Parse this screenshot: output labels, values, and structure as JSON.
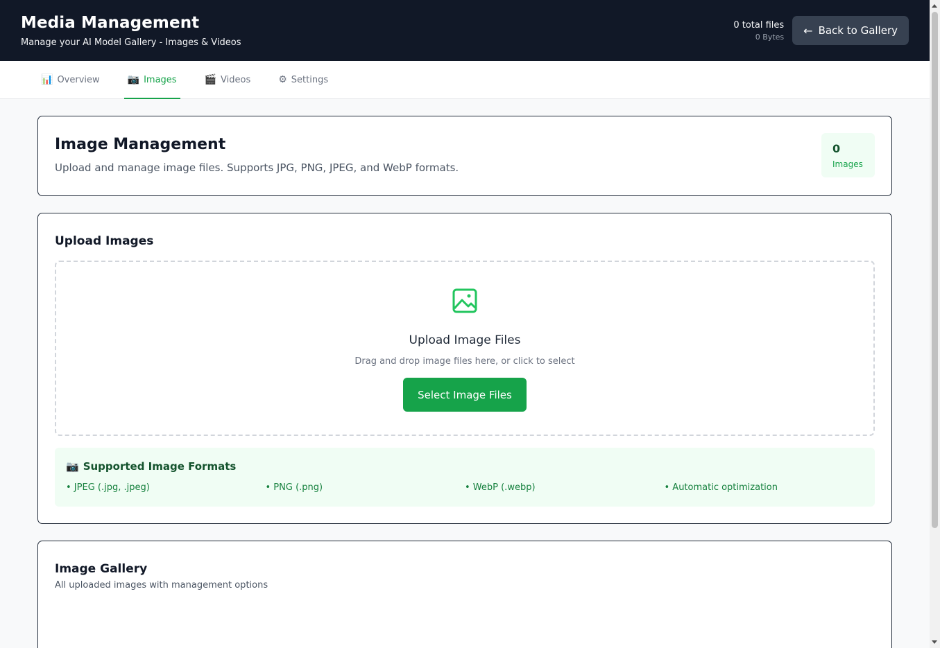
{
  "header": {
    "title": "Media Management",
    "subtitle": "Manage your AI Model Gallery - Images & Videos",
    "total_files": "0 total files",
    "total_bytes": "0 Bytes",
    "back_label": "Back to Gallery"
  },
  "tabs": [
    {
      "icon": "📊",
      "label": "Overview"
    },
    {
      "icon": "📷",
      "label": "Images"
    },
    {
      "icon": "🎬",
      "label": "Videos"
    },
    {
      "icon": "⚙",
      "label": "Settings"
    }
  ],
  "active_tab": "Images",
  "management": {
    "title": "Image Management",
    "description": "Upload and manage image files. Supports JPG, PNG, JPEG, and WebP formats.",
    "count": "0",
    "count_label": "Images"
  },
  "upload": {
    "section_title": "Upload Images",
    "title": "Upload Image Files",
    "hint": "Drag and drop image files here, or click to select",
    "button_label": "Select Image Files"
  },
  "formats": {
    "icon": "📷",
    "title": "Supported Image Formats",
    "items": [
      "• JPEG (.jpg, .jpeg)",
      "• PNG (.png)",
      "• WebP (.webp)",
      "• Automatic optimization"
    ]
  },
  "gallery": {
    "title": "Image Gallery",
    "subtitle": "All uploaded images with management options"
  },
  "colors": {
    "header_bg": "#111827",
    "accent": "#16a34a",
    "formats_bg": "#f0fdf4"
  }
}
